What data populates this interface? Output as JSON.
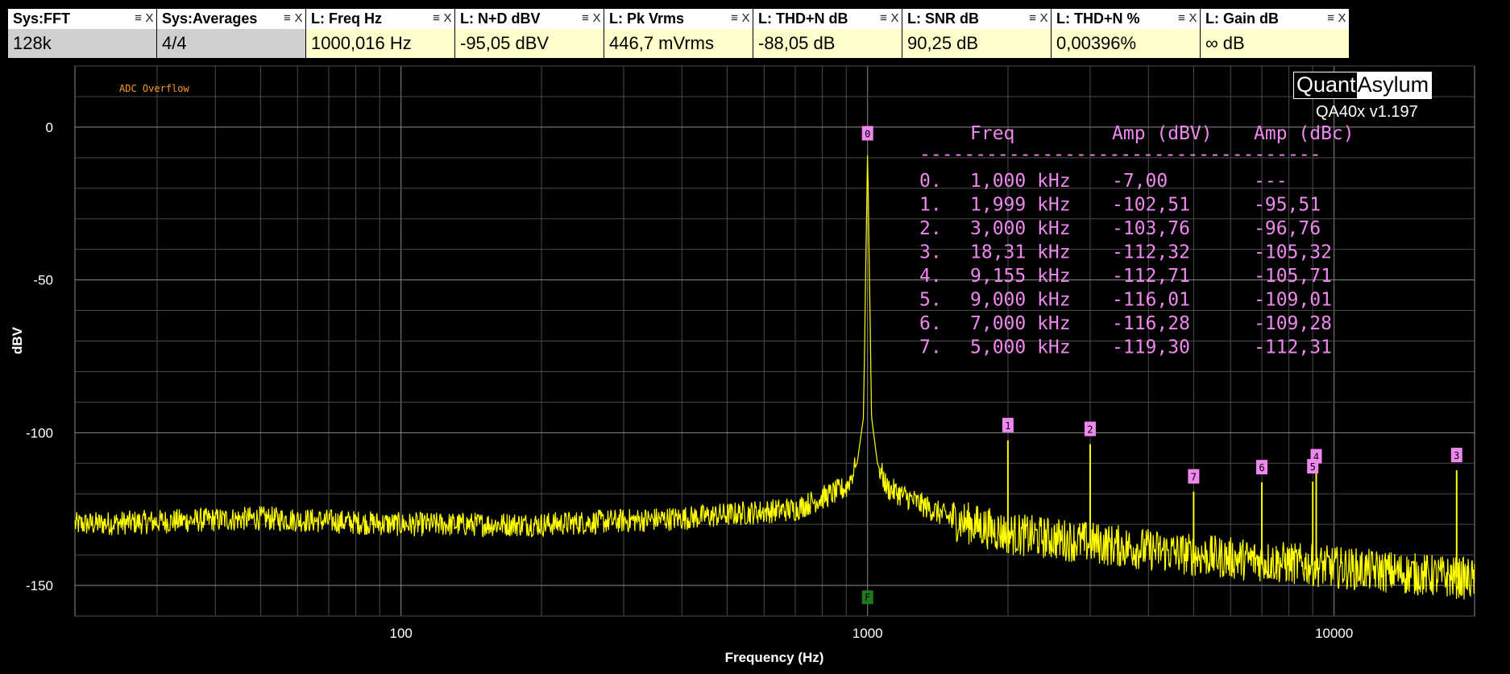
{
  "readouts": [
    {
      "label": "Sys:FFT",
      "value": "128k",
      "kind": "sys"
    },
    {
      "label": "Sys:Averages",
      "value": "4/4",
      "kind": "sys"
    },
    {
      "label": "L: Freq Hz",
      "value": "1000,016 Hz",
      "kind": "meas"
    },
    {
      "label": "L: N+D dBV",
      "value": "-95,05 dBV",
      "kind": "meas"
    },
    {
      "label": "L: Pk Vrms",
      "value": "446,7 mVrms",
      "kind": "meas"
    },
    {
      "label": "L: THD+N dB",
      "value": "-88,05 dB",
      "kind": "meas"
    },
    {
      "label": "L: SNR dB",
      "value": "90,25 dB",
      "kind": "meas"
    },
    {
      "label": "L: THD+N %",
      "value": "0,00396%",
      "kind": "meas"
    },
    {
      "label": "L: Gain dB",
      "value": "∞ dB",
      "kind": "meas"
    }
  ],
  "readout_buttons": {
    "menu": "≡",
    "close": "X"
  },
  "logo": {
    "part1": "Quant",
    "part2": "Asylum",
    "version": "QA40x v1.197"
  },
  "overflow_label": "ADC Overflow",
  "chart_data": {
    "type": "line",
    "xlabel": "Frequency (Hz)",
    "ylabel": "dBV",
    "x_scale": "log",
    "xlim": [
      20,
      20000
    ],
    "ylim": [
      -160,
      20
    ],
    "x_ticks": [
      100,
      1000,
      10000
    ],
    "y_ticks": [
      0,
      -50,
      -100,
      -150
    ],
    "grid": true,
    "series": [
      {
        "color": "#ffff00",
        "noise_floor": [
          [
            20,
            -130
          ],
          [
            50,
            -128
          ],
          [
            100,
            -130
          ],
          [
            200,
            -130
          ],
          [
            400,
            -128
          ],
          [
            700,
            -125
          ],
          [
            900,
            -118
          ],
          [
            950,
            -110
          ],
          [
            980,
            -95
          ],
          [
            1000,
            -7
          ],
          [
            1020,
            -95
          ],
          [
            1050,
            -110
          ],
          [
            1100,
            -118
          ],
          [
            1500,
            -128
          ],
          [
            2000,
            -133
          ],
          [
            3000,
            -136
          ],
          [
            5000,
            -140
          ],
          [
            10000,
            -144
          ],
          [
            20000,
            -148
          ]
        ]
      }
    ],
    "harmonics": [
      {
        "index": "0",
        "freq_hz": 1000,
        "amp_dbv": -7.0
      },
      {
        "index": "1",
        "freq_hz": 1999,
        "amp_dbv": -102.51
      },
      {
        "index": "2",
        "freq_hz": 3000,
        "amp_dbv": -103.76
      },
      {
        "index": "3",
        "freq_hz": 18310,
        "amp_dbv": -112.32
      },
      {
        "index": "4",
        "freq_hz": 9155,
        "amp_dbv": -112.71
      },
      {
        "index": "5",
        "freq_hz": 9000,
        "amp_dbv": -116.01
      },
      {
        "index": "6",
        "freq_hz": 7000,
        "amp_dbv": -116.28
      },
      {
        "index": "7",
        "freq_hz": 5000,
        "amp_dbv": -119.3
      }
    ],
    "fundamental_marker": {
      "label": "F",
      "freq_hz": 1000,
      "amp_dbv": -154
    },
    "table": {
      "headers": [
        "Freq",
        "Amp (dBV)",
        "Amp (dBc)"
      ],
      "divider": "------------------------------------",
      "rows": [
        [
          "0.",
          "1,000 kHz",
          "-7,00",
          "---"
        ],
        [
          "1.",
          "1,999 kHz",
          "-102,51",
          "-95,51"
        ],
        [
          "2.",
          "3,000 kHz",
          "-103,76",
          "-96,76"
        ],
        [
          "3.",
          "18,31 kHz",
          "-112,32",
          "-105,32"
        ],
        [
          "4.",
          "9,155 kHz",
          "-112,71",
          "-105,71"
        ],
        [
          "5.",
          "9,000 kHz",
          "-116,01",
          "-109,01"
        ],
        [
          "6.",
          "7,000 kHz",
          "-116,28",
          "-109,28"
        ],
        [
          "7.",
          "5,000 kHz",
          "-119,30",
          "-112,31"
        ]
      ]
    }
  }
}
